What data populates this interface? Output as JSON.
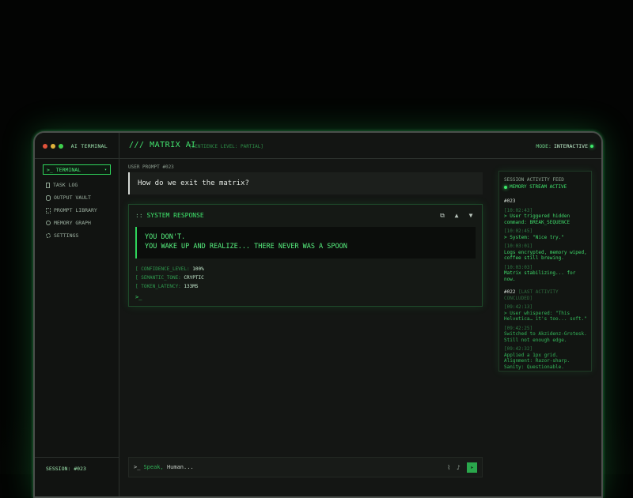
{
  "sidebar": {
    "title": "AI TERMINAL",
    "active_item": "TERMINAL",
    "items": [
      {
        "label": "TASK LOG",
        "icon": "document-icon"
      },
      {
        "label": "OUTPUT VAULT",
        "icon": "database-icon"
      },
      {
        "label": "PROMPT LIBRARY",
        "icon": "library-icon"
      },
      {
        "label": "MEMORY GRAPH",
        "icon": "graph-icon"
      },
      {
        "label": "SETTINGS",
        "icon": "gear-icon"
      }
    ],
    "session": "SESSION: #023"
  },
  "header": {
    "title": "/// MATRIX AI",
    "subtitle": "[SENTIENCE LEVEL: PARTIAL]",
    "mode_label": "MODE:",
    "mode_value": "INTERACTIVE"
  },
  "prompt": {
    "label": "USER PROMPT #023",
    "text": "How do we exit the matrix?"
  },
  "response": {
    "prefix": "::",
    "title": "SYSTEM RESPONSE",
    "line1": "YOU DON'T.",
    "line2": "YOU WAKE UP AND REALIZE... THERE NEVER WAS A SPOON",
    "confidence_label": "[ CONFIDENCE_LEVEL:",
    "confidence_value": "100%",
    "tone_label": "[ SEMANTIC_TONE:",
    "tone_value": "CRYPTIC",
    "latency_label": "[ TOKEN_LATENCY:",
    "latency_value": "133MS",
    "cursor": ">_"
  },
  "feed": {
    "title": "SESSION ACTIVITY FEED",
    "status": "MEMORY STREAM ACTIVE",
    "s1": "#023",
    "e1_ts": "[10:02:43]",
    "e1_text": "> User triggered hidden command: BREAK_SEQUENCE",
    "e2_ts": "[10:02:45]",
    "e2_text": "> System: \"Nice try.\"",
    "e3_ts": "[10:03:01]",
    "e3_text": "Logs encrypted, memory wiped, coffee still brewing.",
    "e4_ts": "[10:03:03]",
    "e4_text": "Matrix stabilizing... for now.",
    "s2": "#022",
    "s2_note": "[LAST ACTIVITY CONCLUDED]",
    "e5_ts": "[09:42:13]",
    "e5_text": "> User whispered: \"This Helvetica… it's too... soft.\"",
    "e6_ts": "[09:42:25]",
    "e6_text": "Switched to Akzidenz-Grotesk. Still not enough edge.",
    "e7_ts": "[09:42:32]",
    "e7_text": "Applied a 1px grid. Alignment: Razor-sharp. Sanity: Questionable."
  },
  "input": {
    "prompt": ">_",
    "placeholder_a": "Speak,",
    "placeholder_b": "Human..."
  }
}
